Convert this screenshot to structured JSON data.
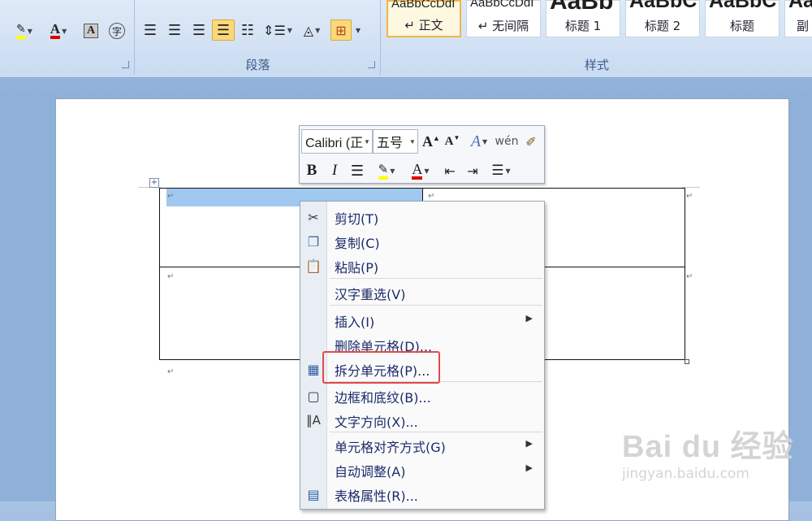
{
  "ribbon": {
    "font_group": {
      "label": ""
    },
    "paragraph_group": {
      "label": "段落"
    },
    "styles_group": {
      "label": "样式",
      "items": [
        {
          "preview": "AaBbCcDdI",
          "name": "↵ 正文"
        },
        {
          "preview": "AaBbCcDdI",
          "name": "↵ 无间隔"
        },
        {
          "preview": "AaBb",
          "name": "标题 1"
        },
        {
          "preview": "AaBbC",
          "name": "标题 2"
        },
        {
          "preview": "AaBbC",
          "name": "标题"
        },
        {
          "preview": "Aa",
          "name": "副"
        }
      ]
    }
  },
  "mini_toolbar": {
    "font_name": "Calibri (正",
    "font_size": "五号",
    "bold": "B",
    "italic": "I",
    "font_color_letter": "A"
  },
  "document": {
    "paragraph_mark": "↵"
  },
  "context_menu": {
    "items": [
      {
        "label": "剪切(T)",
        "icon": "scissors-icon"
      },
      {
        "label": "复制(C)",
        "icon": "copy-icon"
      },
      {
        "label": "粘贴(P)",
        "icon": "paste-icon"
      },
      {
        "label": "汉字重选(V)",
        "icon": ""
      },
      {
        "label": "插入(I)",
        "icon": "",
        "submenu": true
      },
      {
        "label": "删除单元格(D)...",
        "icon": ""
      },
      {
        "label": "拆分单元格(P)...",
        "icon": "split-cells-icon"
      },
      {
        "label": "边框和底纹(B)...",
        "icon": "borders-icon"
      },
      {
        "label": "文字方向(X)...",
        "icon": "text-direction-icon"
      },
      {
        "label": "单元格对齐方式(G)",
        "icon": "",
        "submenu": true
      },
      {
        "label": "自动调整(A)",
        "icon": "",
        "submenu": true
      },
      {
        "label": "表格属性(R)...",
        "icon": "table-properties-icon"
      }
    ]
  },
  "watermark": {
    "logo": "Bai du 经验",
    "url": "jingyan.baidu.com"
  },
  "colors": {
    "highlight_yellow": "#ffff00",
    "font_red": "#e00000",
    "annotation_red": "#e14a4a"
  }
}
